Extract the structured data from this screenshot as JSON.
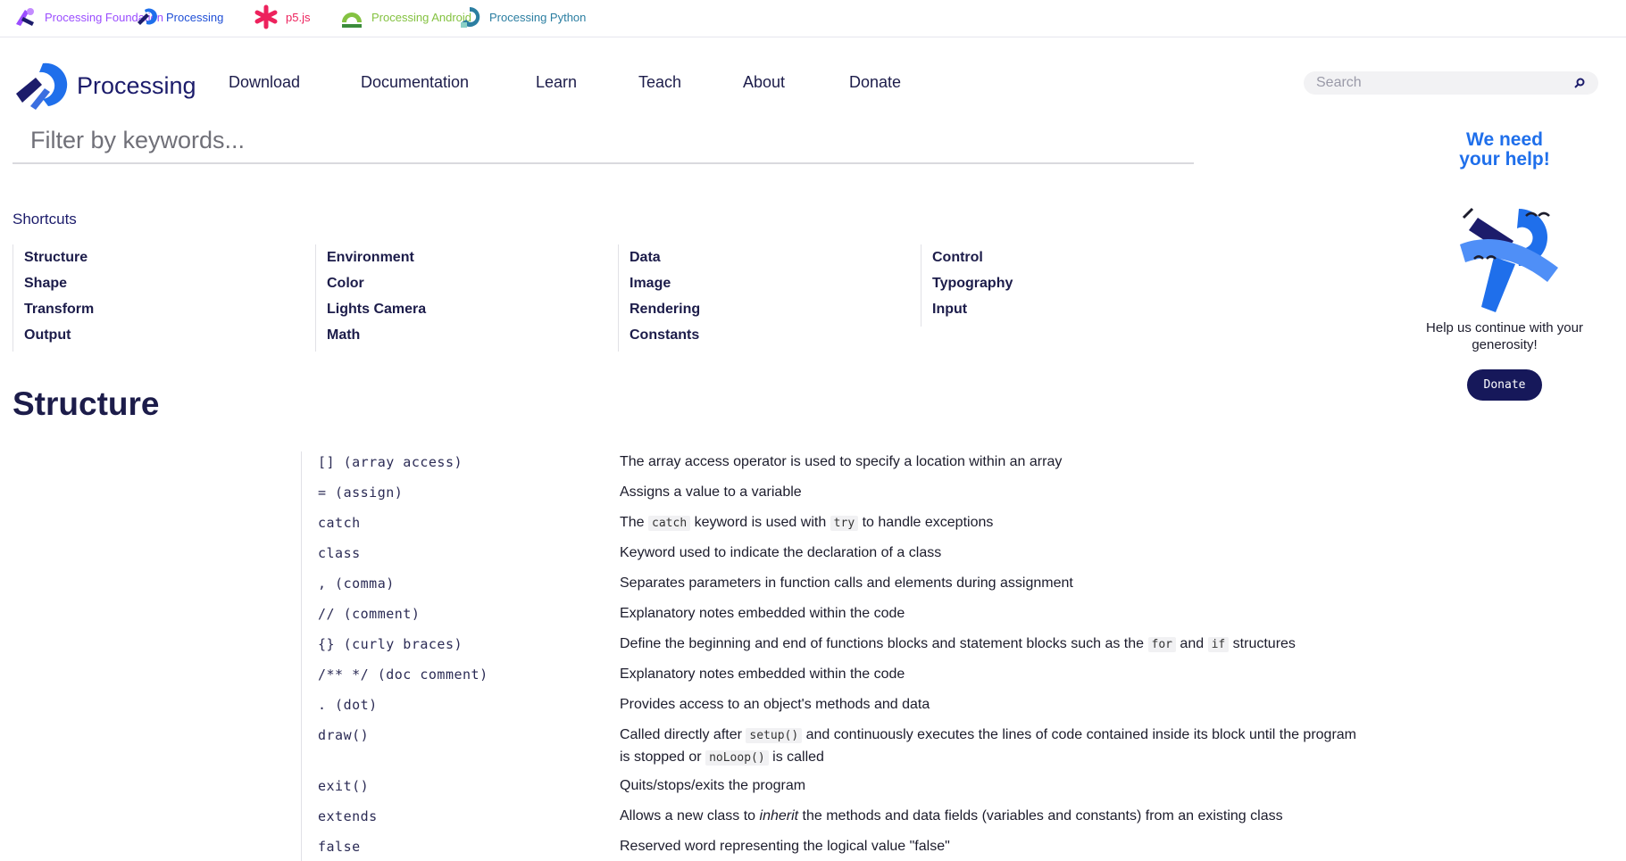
{
  "sites": [
    {
      "label": "Processing Foundation",
      "color": "#9b4dff"
    },
    {
      "label": "Processing",
      "color": "#1f4fd6"
    },
    {
      "label": "p5.js",
      "color": "#ed225d"
    },
    {
      "label": "Processing Android",
      "color": "#84c241"
    },
    {
      "label": "Processing Python",
      "color": "#2b7ea1"
    }
  ],
  "header": {
    "brand": "Processing",
    "nav": [
      "Download",
      "Documentation",
      "Learn",
      "Teach",
      "About",
      "Donate"
    ],
    "search_placeholder": "Search"
  },
  "filter": {
    "placeholder": "Filter by keywords..."
  },
  "shortcuts": {
    "title": "Shortcuts",
    "columns": [
      [
        "Structure",
        "Shape",
        "Transform",
        "Output"
      ],
      [
        "Environment",
        "Color",
        "Lights Camera",
        "Math"
      ],
      [
        "Data",
        "Image",
        "Rendering",
        "Constants"
      ],
      [
        "Control",
        "Typography",
        "Input"
      ]
    ]
  },
  "section": {
    "title": "Structure",
    "rows": [
      {
        "kw": "[] (array access)",
        "desc": [
          "The array access operator is used to specify a location within an array"
        ]
      },
      {
        "kw": "= (assign)",
        "desc": [
          "Assigns a value to a variable"
        ]
      },
      {
        "kw": "catch",
        "desc": [
          "The ",
          {
            "code": "catch"
          },
          " keyword is used with ",
          {
            "code": "try"
          },
          " to handle exceptions"
        ]
      },
      {
        "kw": "class",
        "desc": [
          "Keyword used to indicate the declaration of a class"
        ]
      },
      {
        "kw": ", (comma)",
        "desc": [
          "Separates parameters in function calls and elements during assignment"
        ]
      },
      {
        "kw": "// (comment)",
        "desc": [
          "Explanatory notes embedded within the code"
        ]
      },
      {
        "kw": "{} (curly braces)",
        "desc": [
          "Define the beginning and end of functions blocks and statement blocks such as the ",
          {
            "code": "for"
          },
          " and ",
          {
            "code": "if"
          },
          " structures"
        ]
      },
      {
        "kw": "/** */ (doc comment)",
        "desc": [
          "Explanatory notes embedded within the code"
        ]
      },
      {
        "kw": ". (dot)",
        "desc": [
          "Provides access to an object's methods and data"
        ]
      },
      {
        "kw": "draw()",
        "desc": [
          "Called directly after ",
          {
            "code": "setup()"
          },
          " and continuously executes the lines of code contained inside its block until the program is stopped or ",
          {
            "code": "noLoop()"
          },
          " is called"
        ]
      },
      {
        "kw": "exit()",
        "desc": [
          "Quits/stops/exits the program"
        ]
      },
      {
        "kw": "extends",
        "desc": [
          "Allows a new class to ",
          {
            "em": "inherit"
          },
          " the methods and data fields (variables and constants) from an existing class"
        ]
      },
      {
        "kw": "false",
        "desc": [
          "Reserved word representing the logical value \"false\""
        ]
      }
    ]
  },
  "help": {
    "heading_line1": "We need",
    "heading_line2": "your help!",
    "text": "Help us continue with your generosity!",
    "button": "Donate"
  }
}
